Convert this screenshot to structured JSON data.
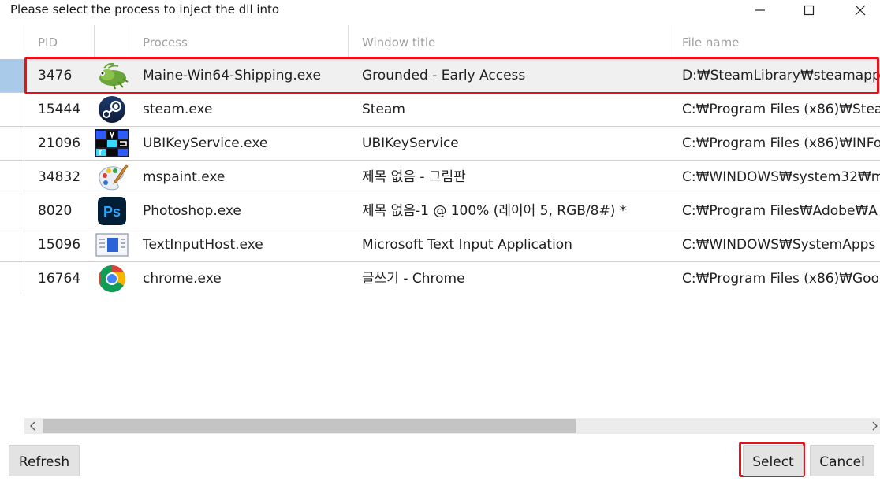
{
  "window": {
    "title": "Please select the process to inject the dll into"
  },
  "columns": {
    "pid": "PID",
    "process": "Process",
    "window_title": "Window title",
    "file_name": "File name"
  },
  "rows": [
    {
      "pid": "3476",
      "process": "Maine-Win64-Shipping.exe",
      "window_title": "Grounded - Early Access",
      "file_name": "D:₩SteamLibrary₩steamapps",
      "icon": "grounded-ant-icon"
    },
    {
      "pid": "15444",
      "process": "steam.exe",
      "window_title": "Steam",
      "file_name": "C:₩Program Files (x86)₩Stea",
      "icon": "steam-icon"
    },
    {
      "pid": "21096",
      "process": "UBIKeyService.exe",
      "window_title": "UBIKeyService",
      "file_name": "C:₩Program Files (x86)₩INFo",
      "icon": "ubikey-icon"
    },
    {
      "pid": "34832",
      "process": "mspaint.exe",
      "window_title": "제목 없음 - 그림판",
      "file_name": "C:₩WINDOWS₩system32₩m",
      "icon": "paint-palette-icon"
    },
    {
      "pid": "8020",
      "process": "Photoshop.exe",
      "window_title": "제목 없음-1 @ 100% (레이어 5, RGB/8#) *",
      "file_name": "C:₩Program Files₩Adobe₩A",
      "icon": "photoshop-icon"
    },
    {
      "pid": "15096",
      "process": "TextInputHost.exe",
      "window_title": "Microsoft Text Input Application",
      "file_name": "C:₩WINDOWS₩SystemApps",
      "icon": "text-input-host-icon"
    },
    {
      "pid": "16764",
      "process": "chrome.exe",
      "window_title": "글쓰기 - Chrome",
      "file_name": "C:₩Program Files (x86)₩Goo",
      "icon": "chrome-icon"
    }
  ],
  "selected_row_index": 0,
  "buttons": {
    "refresh": "Refresh",
    "select": "Select",
    "cancel": "Cancel"
  },
  "colors": {
    "highlight": "#e8111a",
    "selected_row_indicator": "#a9cbe9"
  }
}
